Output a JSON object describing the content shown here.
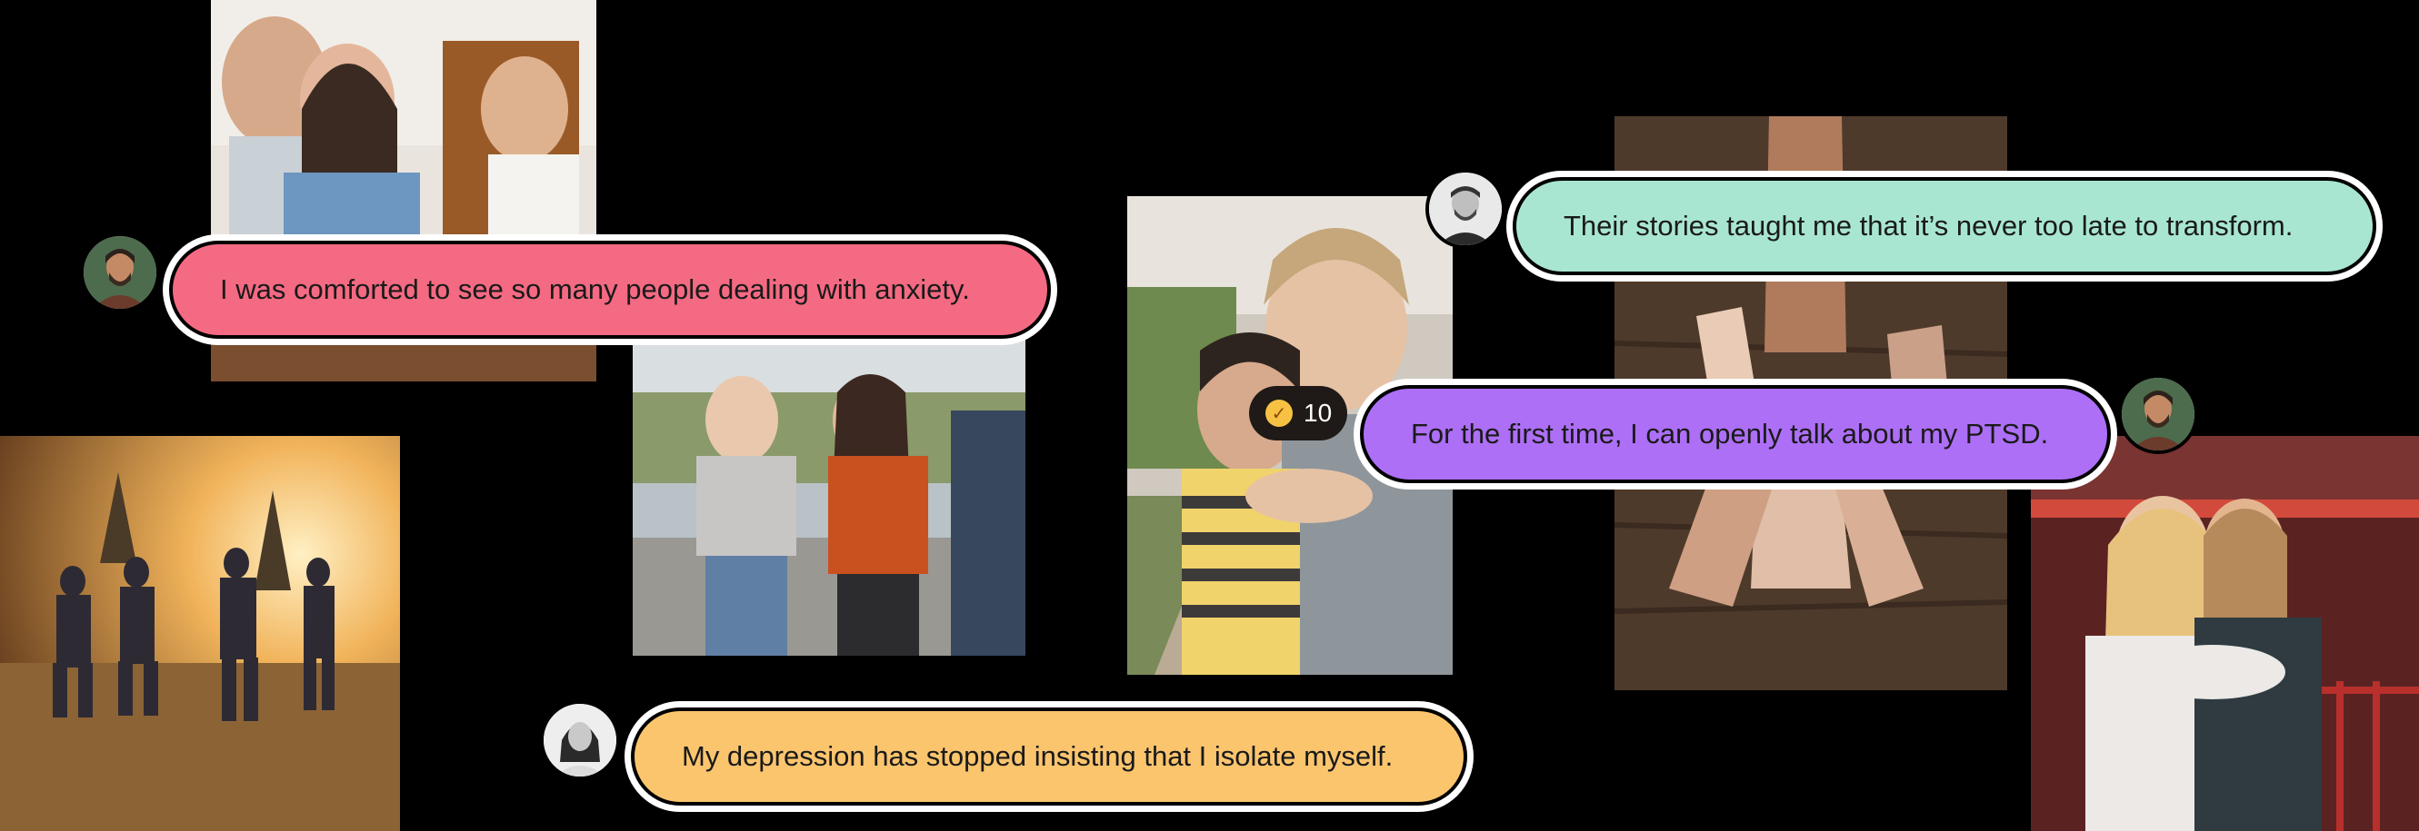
{
  "testimonials": [
    {
      "text": "I was comforted to see so many people dealing with anxiety.",
      "color": "#f46a82"
    },
    {
      "text": "Their stories taught me that it’s never too late to transform.",
      "color": "#a8e6d1"
    },
    {
      "text": "For the first time, I can openly talk about my PTSD.",
      "color": "#ad6ff6"
    },
    {
      "text": "My depression has stopped insisting that I isolate myself.",
      "color": "#fbc56e"
    }
  ],
  "reaction": {
    "icon": "ok-hand-emoji-icon",
    "count": "10"
  },
  "photos": [
    "friends-laptop-photo",
    "women-laughing-photo",
    "sunset-running-photo",
    "friends-hugging-photo",
    "stacked-hands-photo",
    "two-women-hug-photo"
  ]
}
